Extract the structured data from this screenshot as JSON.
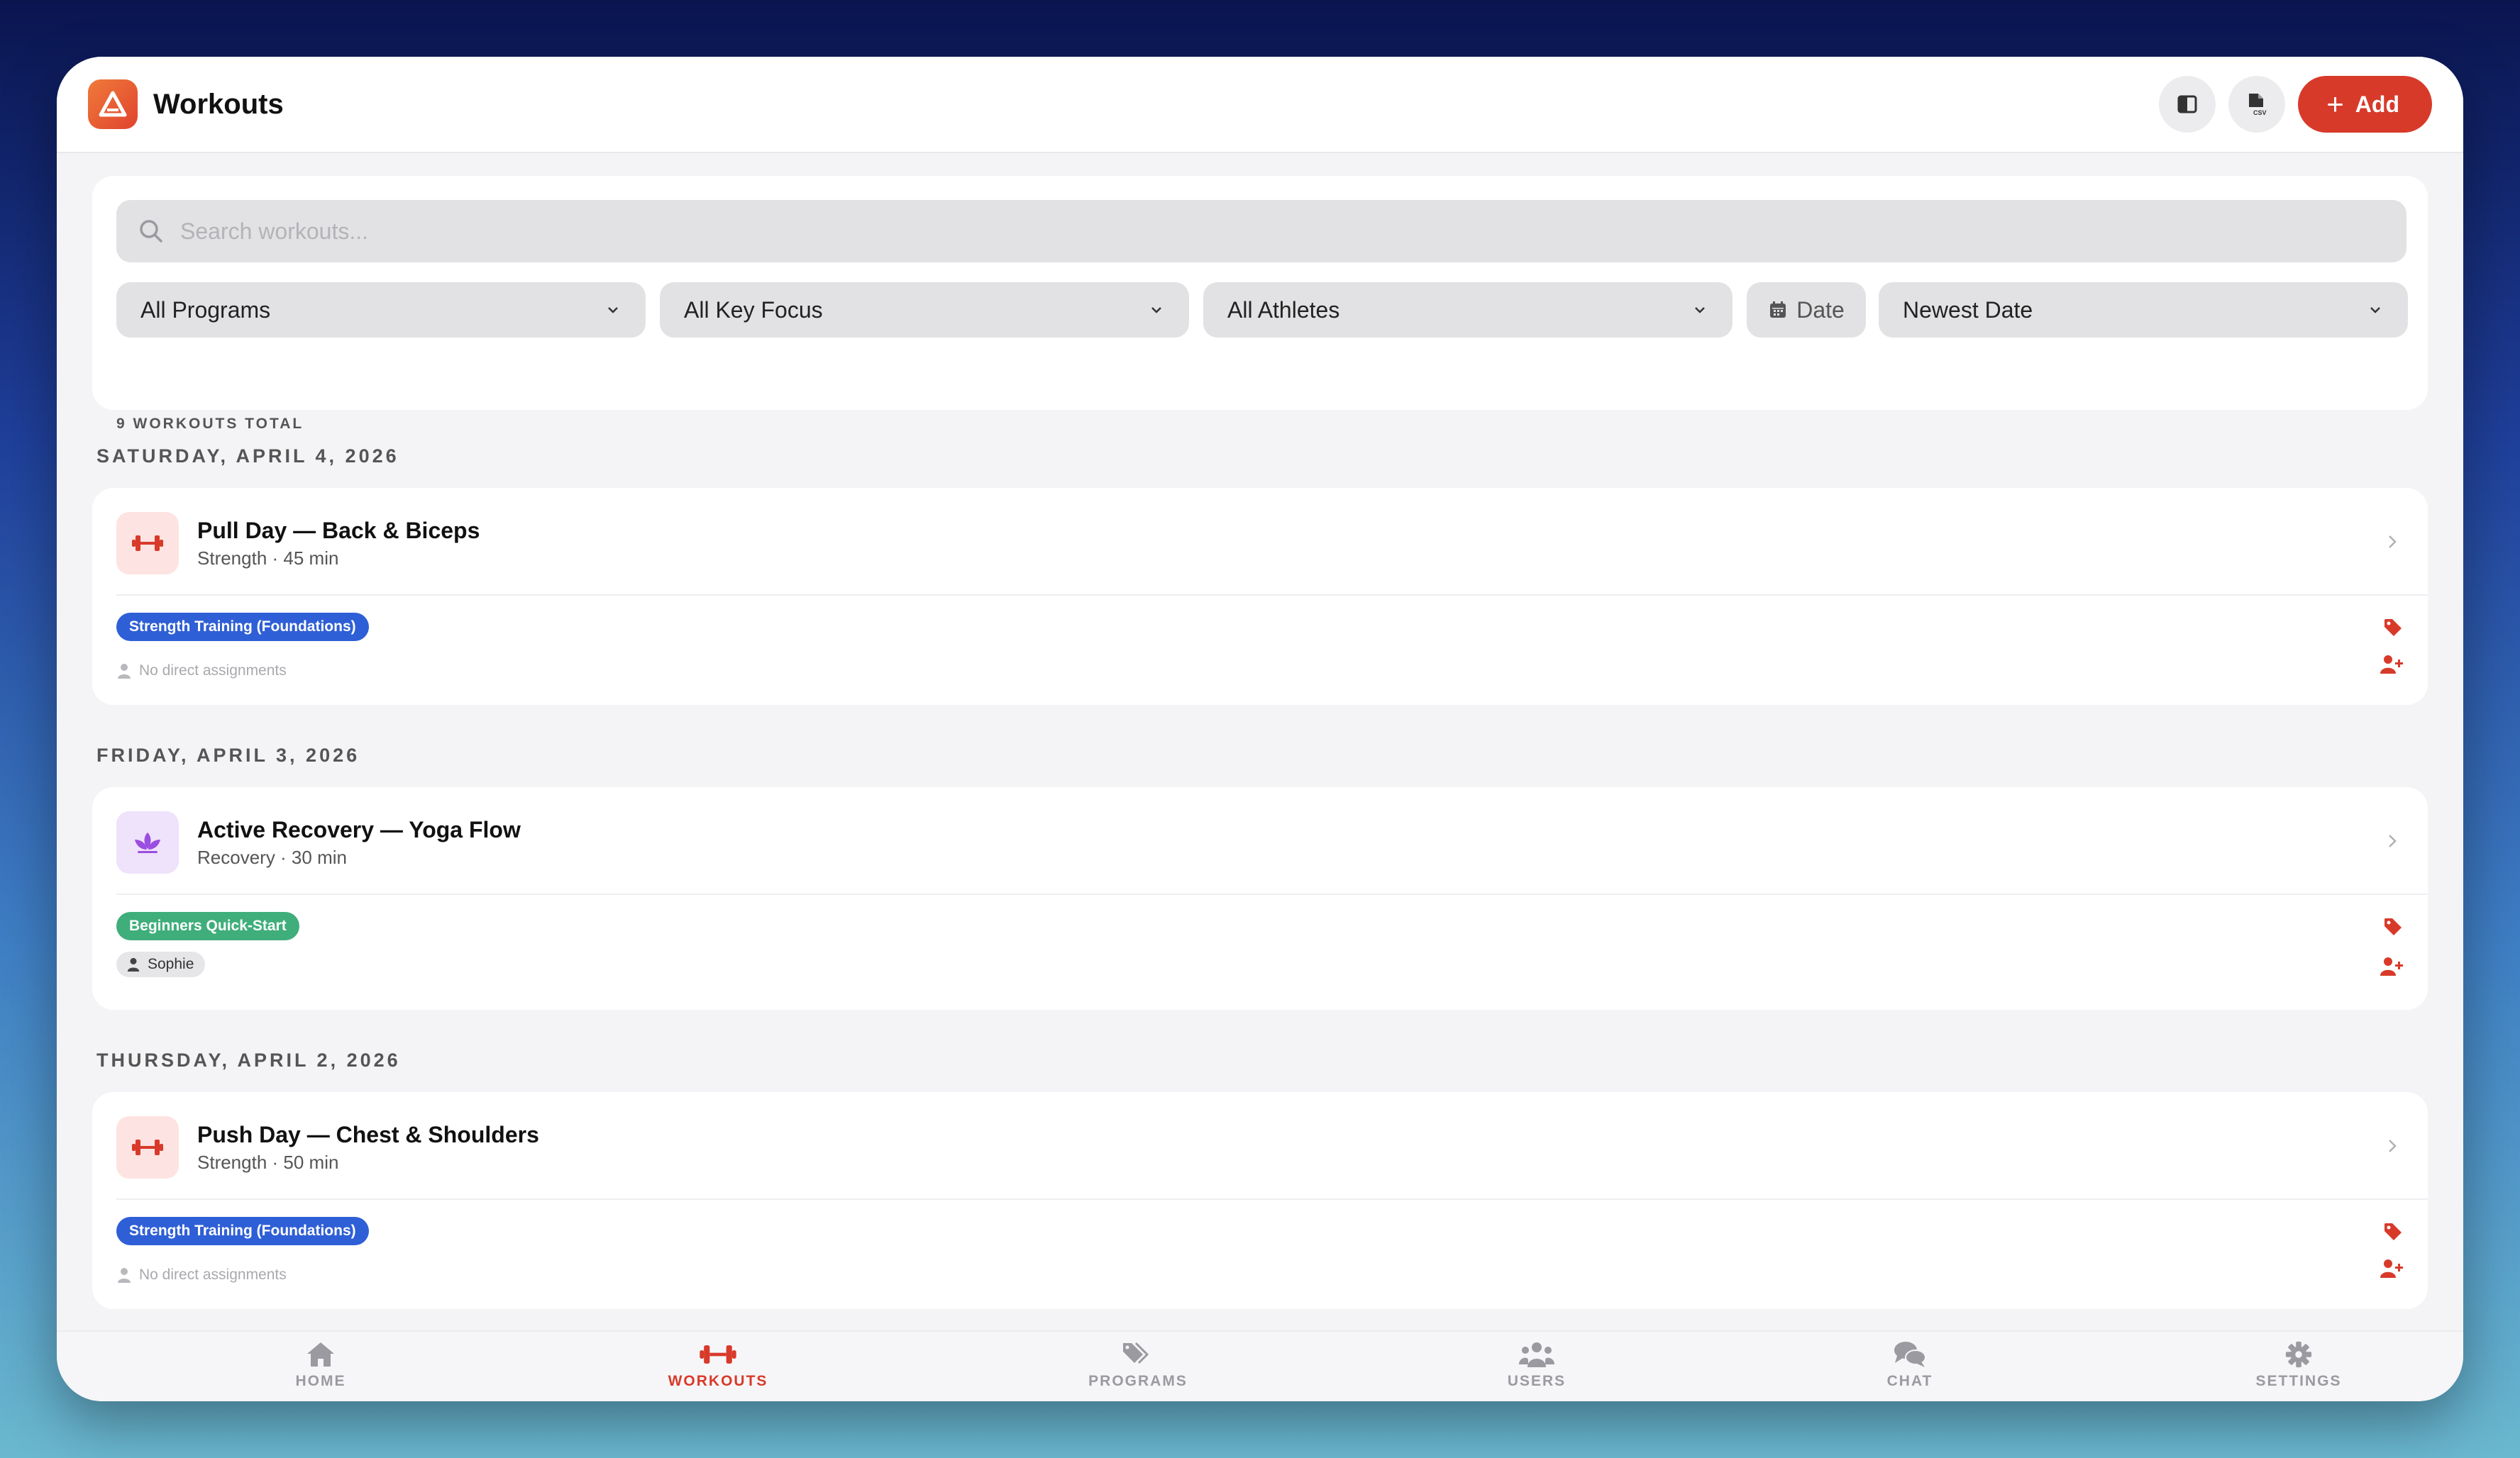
{
  "header": {
    "title": "Workouts",
    "add_label": "Add",
    "csv_label": "CSV"
  },
  "filters": {
    "search_placeholder": "Search workouts...",
    "programs": "All Programs",
    "key_focus": "All Key Focus",
    "athletes": "All Athletes",
    "date_label": "Date",
    "sort": "Newest Date",
    "total": "9 WORKOUTS TOTAL"
  },
  "days": [
    {
      "label": "SATURDAY, APRIL 4, 2026",
      "workout": {
        "title": "Pull Day — Back & Biceps",
        "subtitle": "Strength · 45 min",
        "icon": "dumbbell-icon",
        "tag": "Strength Training (Foundations)",
        "tag_color": "#2f5fd6",
        "assignment": "No direct assignments"
      }
    },
    {
      "label": "FRIDAY, APRIL 3, 2026",
      "workout": {
        "title": "Active Recovery — Yoga Flow",
        "subtitle": "Recovery · 30 min",
        "icon": "lotus-icon",
        "tag": "Beginners Quick-Start",
        "tag_color": "#3fae7a",
        "assignment": "Sophie"
      }
    },
    {
      "label": "THURSDAY, APRIL 2, 2026",
      "workout": {
        "title": "Push Day — Chest & Shoulders",
        "subtitle": "Strength · 50 min",
        "icon": "dumbbell-icon",
        "tag": "Strength Training (Foundations)",
        "tag_color": "#2f5fd6",
        "assignment": "No direct assignments"
      }
    }
  ],
  "nav": [
    {
      "label": "HOME",
      "icon": "home-icon",
      "active": false
    },
    {
      "label": "WORKOUTS",
      "icon": "dumbbell-icon",
      "active": true
    },
    {
      "label": "PROGRAMS",
      "icon": "tags-icon",
      "active": false
    },
    {
      "label": "USERS",
      "icon": "users-icon",
      "active": false
    },
    {
      "label": "CHAT",
      "icon": "chat-icon",
      "active": false
    },
    {
      "label": "SETTINGS",
      "icon": "gear-icon",
      "active": false
    }
  ],
  "colors": {
    "accent": "#d83a2a",
    "program_blue": "#2f5fd6",
    "program_green": "#3fae7a"
  }
}
